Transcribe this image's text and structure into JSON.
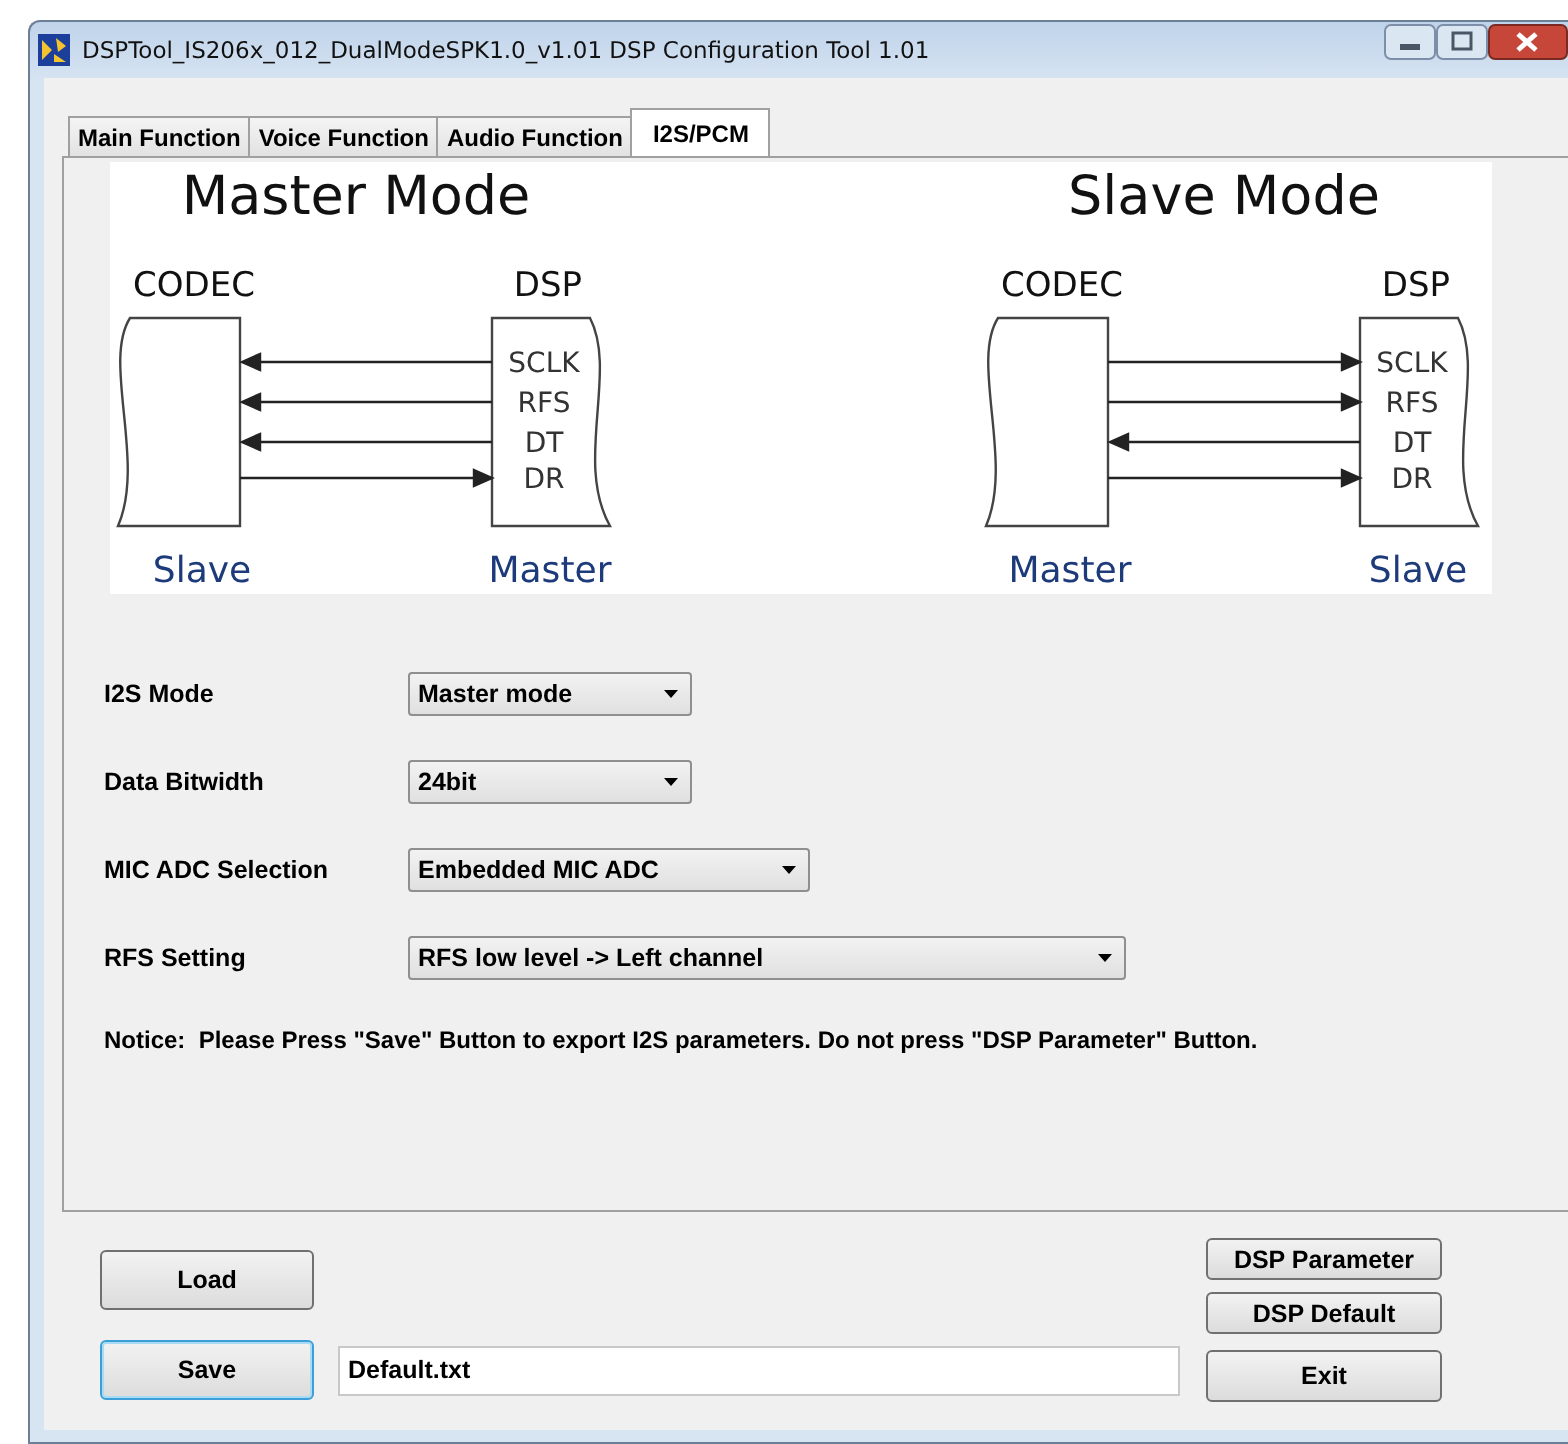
{
  "window": {
    "title": "DSPTool_IS206x_012_DualModeSPK1.0_v1.01 DSP Configuration Tool 1.01"
  },
  "tabs": [
    {
      "label": "Main Function",
      "selected": false
    },
    {
      "label": "Voice Function",
      "selected": false
    },
    {
      "label": "Audio Function",
      "selected": false
    },
    {
      "label": "I2S/PCM",
      "selected": true
    }
  ],
  "diagram": {
    "modes": [
      {
        "title": "Master Mode",
        "codec_label": "CODEC",
        "dsp_label": "DSP",
        "codec_role": "Slave",
        "dsp_role": "Master",
        "signals": [
          {
            "label": "SCLK",
            "kind": "to_codec"
          },
          {
            "label": "RFS",
            "kind": "to_codec"
          },
          {
            "label": "DT",
            "kind": "to_codec"
          },
          {
            "label": "DR",
            "kind": "to_dsp"
          }
        ]
      },
      {
        "title": "Slave Mode",
        "codec_label": "CODEC",
        "dsp_label": "DSP",
        "codec_role": "Master",
        "dsp_role": "Slave",
        "signals": [
          {
            "label": "SCLK",
            "kind": "to_dsp"
          },
          {
            "label": "RFS",
            "kind": "to_dsp"
          },
          {
            "label": "DT",
            "kind": "to_codec"
          },
          {
            "label": "DR",
            "kind": "to_dsp"
          }
        ]
      }
    ]
  },
  "settings": [
    {
      "label": "I2S Mode",
      "value": "Master mode"
    },
    {
      "label": "Data Bitwidth",
      "value": "24bit"
    },
    {
      "label": "MIC ADC Selection",
      "value": "Embedded MIC ADC"
    },
    {
      "label": "RFS Setting",
      "value": "RFS low level -> Left channel"
    }
  ],
  "notice": "Notice:  Please Press \"Save\" Button to export I2S parameters. Do not press \"DSP Parameter\" Button.",
  "buttons": {
    "load": "Load",
    "save": "Save",
    "dsp_parameter": "DSP Parameter",
    "dsp_default": "DSP Default",
    "exit": "Exit"
  },
  "file_field": {
    "value": "Default.txt"
  }
}
